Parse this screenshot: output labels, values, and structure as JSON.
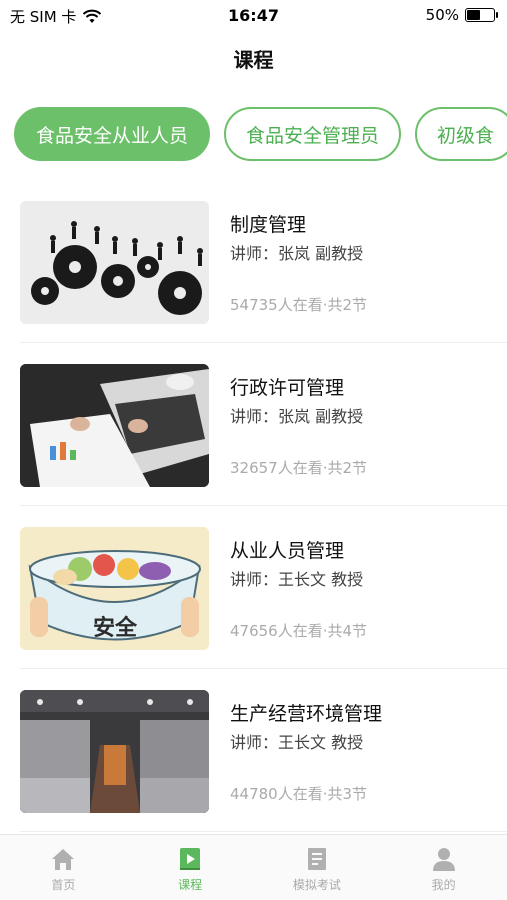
{
  "status_bar": {
    "carrier": "无 SIM 卡",
    "time": "16:47",
    "battery": "50%",
    "battery_level": 0.5
  },
  "header": {
    "title": "课程"
  },
  "categories": [
    {
      "label": "食品安全从业人员",
      "active": true
    },
    {
      "label": "食品安全管理员",
      "active": false
    },
    {
      "label": "初级食",
      "active": false
    }
  ],
  "courses": [
    {
      "title": "制度管理",
      "teacher": "讲师：张岚 副教授",
      "stats": "54735人在看·共2节"
    },
    {
      "title": "行政许可管理",
      "teacher": "讲师：张岚 副教授",
      "stats": "32657人在看·共2节"
    },
    {
      "title": "从业人员管理",
      "teacher": "讲师：王长文 教授",
      "stats": "47656人在看·共4节",
      "thumb_text": "安全"
    },
    {
      "title": "生产经营环境管理",
      "teacher": "讲师：王长文 教授",
      "stats": "44780人在看·共3节"
    }
  ],
  "tabs": [
    {
      "label": "首页",
      "icon": "home-icon",
      "active": false
    },
    {
      "label": "课程",
      "icon": "course-icon",
      "active": true
    },
    {
      "label": "模拟考试",
      "icon": "exam-icon",
      "active": false
    },
    {
      "label": "我的",
      "icon": "profile-icon",
      "active": false
    }
  ],
  "colors": {
    "accent": "#6cc06a",
    "inactive": "#aaaaaa"
  }
}
